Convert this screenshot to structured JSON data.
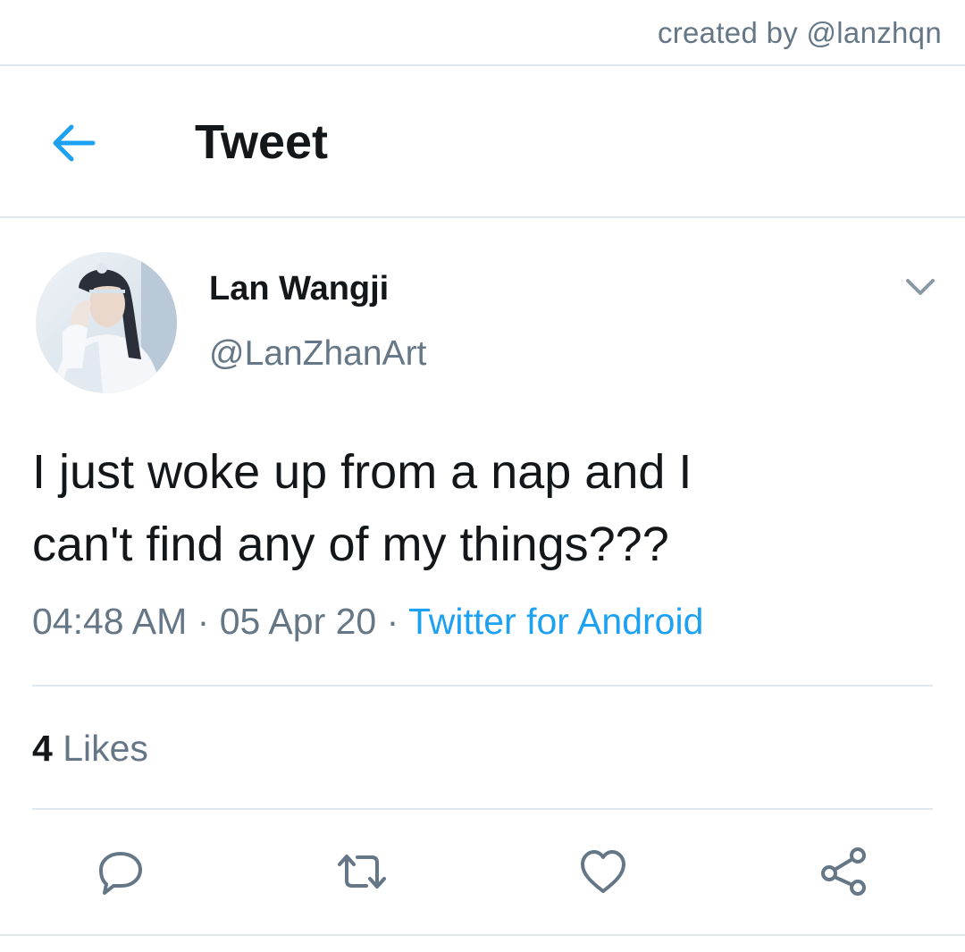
{
  "credit": "created by @lanzhqn",
  "header": {
    "title": "Tweet",
    "back_icon": "arrow-left-icon"
  },
  "tweet": {
    "display_name": "Lan Wangji",
    "handle": "@LanZhanArt",
    "text_line1": "I just woke up from a nap and I",
    "text_line2": "can't find any of my things???",
    "time": "04:48 AM",
    "date": "05 Apr 20",
    "separator": "·",
    "source": "Twitter for Android",
    "likes_count": "4",
    "likes_label": "Likes"
  },
  "actions": [
    {
      "icon": "reply-icon"
    },
    {
      "icon": "retweet-icon"
    },
    {
      "icon": "heart-icon"
    },
    {
      "icon": "share-icon"
    }
  ],
  "colors": {
    "accent": "#1da1f2",
    "text": "#14171a",
    "secondary": "#657786",
    "divider": "#e1e8ed"
  }
}
